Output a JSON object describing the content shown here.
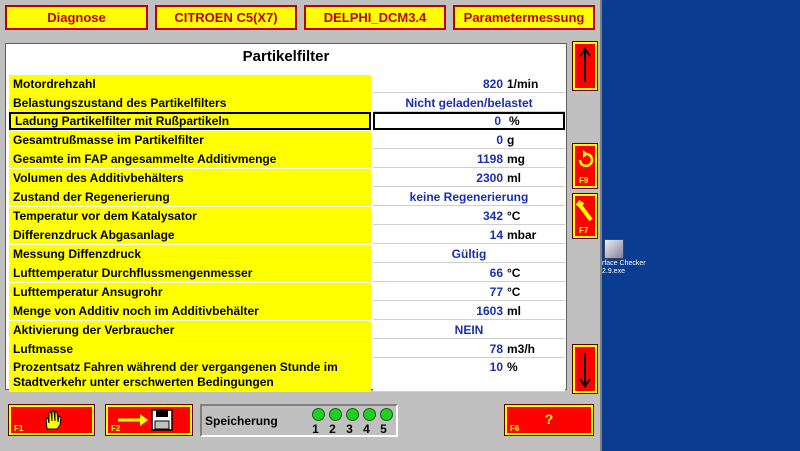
{
  "header": {
    "diagnose": "Diagnose",
    "vehicle": "CITROEN C5(X7)",
    "ecu": "DELPHI_DCM3.4",
    "mode": "Parametermessung"
  },
  "panel": {
    "title": "Partikelfilter",
    "rows": [
      {
        "label": "Motordrehzahl",
        "value": "820",
        "unit": "1/min"
      },
      {
        "label": "Belastungszustand des Partikelfilters",
        "text": "Nicht geladen/belastet"
      },
      {
        "label": "Ladung Partikelfilter mit Rußpartikeln",
        "value": "0",
        "unit": "%"
      },
      {
        "label": "Gesamtrußmasse im Partikelfilter",
        "value": "0",
        "unit": "g"
      },
      {
        "label": "Gesamte im FAP angesammelte Additivmenge",
        "value": "1198",
        "unit": "mg"
      },
      {
        "label": "Volumen des Additivbehälters",
        "value": "2300",
        "unit": "ml"
      },
      {
        "label": "Zustand der Regenerierung",
        "text": "keine Regenerierung"
      },
      {
        "label": "Temperatur vor dem Katalysator",
        "value": "342",
        "unit": "°C"
      },
      {
        "label": "Differenzdruck Abgasanlage",
        "value": "14",
        "unit": "mbar"
      },
      {
        "label": "Messung Diffenzdruck",
        "text": "Gültig"
      },
      {
        "label": "Lufttemperatur Durchflussmengenmesser",
        "value": "66",
        "unit": "°C"
      },
      {
        "label": "Lufttemperatur Ansugrohr",
        "value": "77",
        "unit": "°C"
      },
      {
        "label": "Menge von Additiv noch im Additivbehälter",
        "value": "1603",
        "unit": "ml"
      },
      {
        "label": "Aktivierung der Verbraucher",
        "text": "NEIN"
      },
      {
        "label": "Luftmasse",
        "value": "78",
        "unit": "m3/h"
      },
      {
        "label": "Prozentsatz Fahren während der vergangenen Stunde im Stadtverkehr unter erschwerten Bedingungen",
        "value": "10",
        "unit": "%"
      }
    ]
  },
  "side": {
    "up_icon": "arrow-up-icon",
    "refresh_key": "F9",
    "tool_key": "F7",
    "down_icon": "arrow-down-icon"
  },
  "footer": {
    "stop_key": "F1",
    "save_key": "F2",
    "help_key": "F6",
    "help_label": "?",
    "save_label": "Speicherung",
    "slots": [
      "1",
      "2",
      "3",
      "4",
      "5"
    ]
  },
  "desktop": {
    "icon_line1": "rface Checker",
    "icon_line2": "2.9.exe"
  },
  "colors": {
    "accent": "#ff0000",
    "label_bg": "#ffff00",
    "value_text": "#1a2fb0",
    "desktop": "#0a3d91",
    "led": "#20d020"
  }
}
